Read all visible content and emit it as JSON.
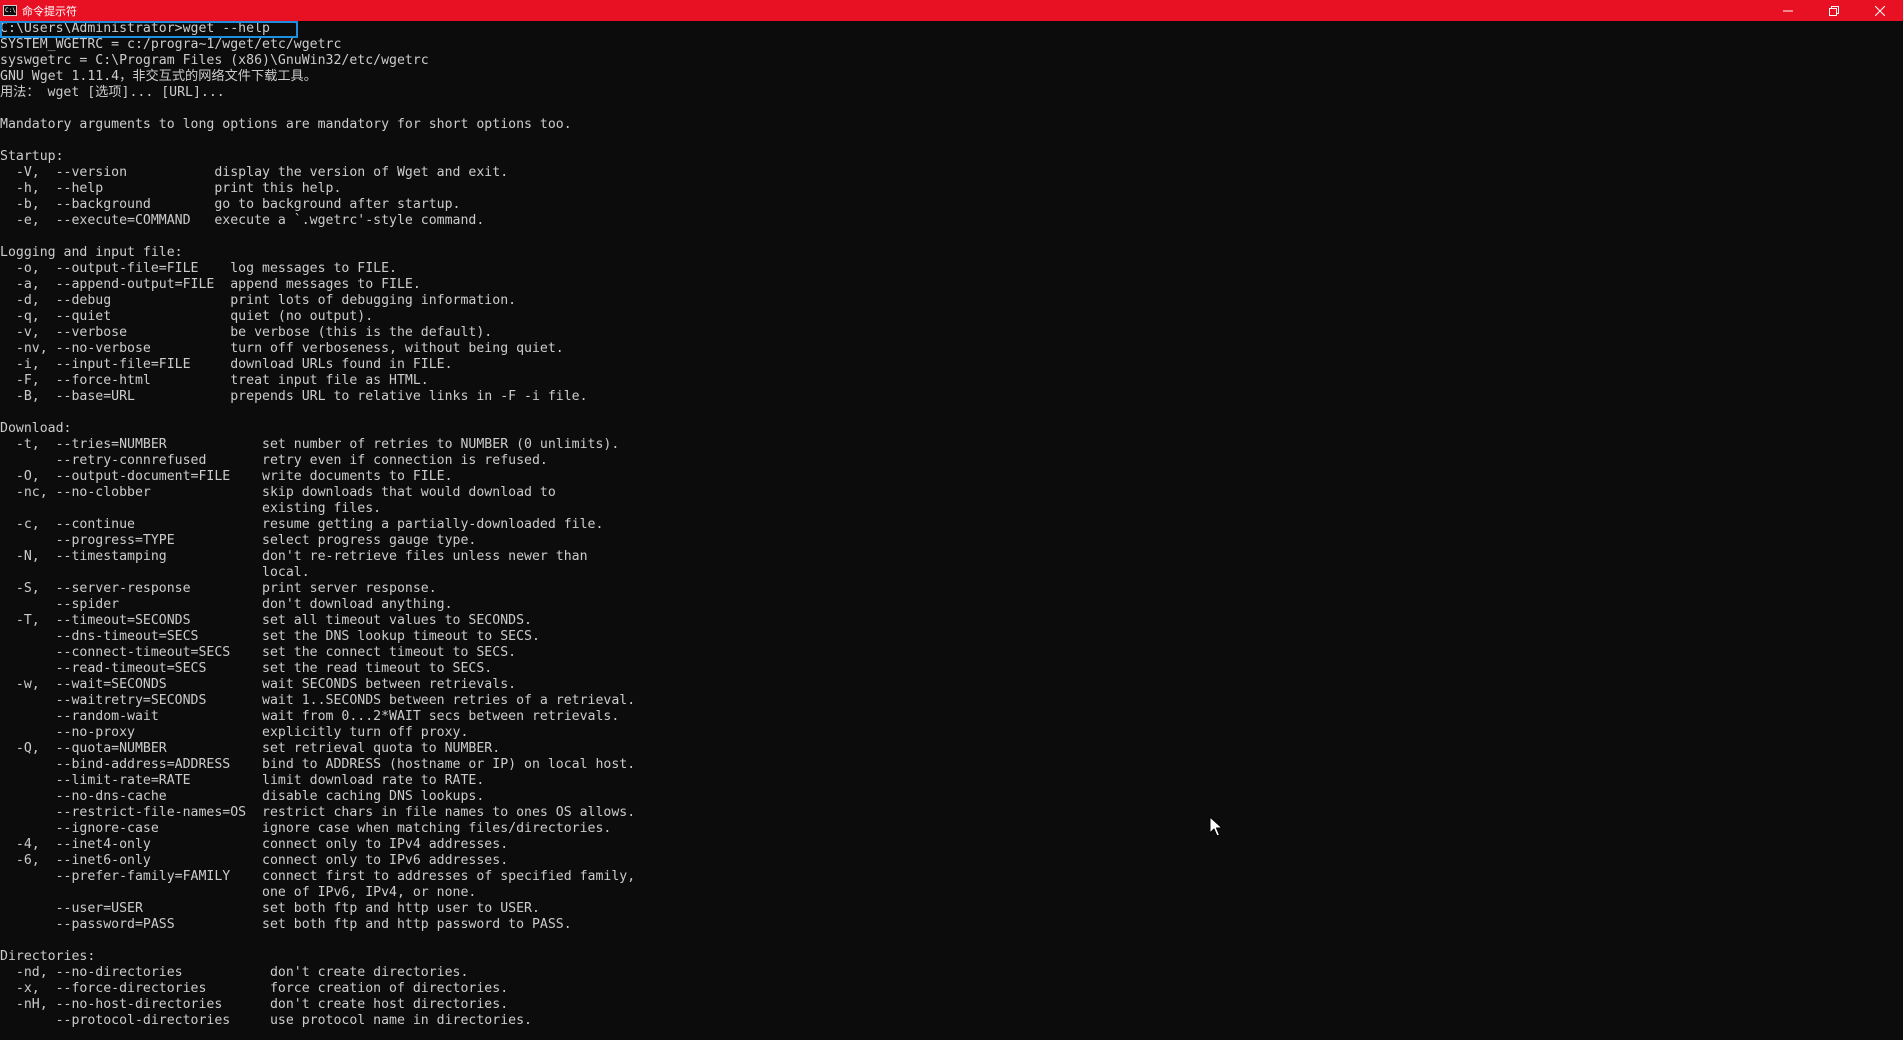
{
  "window": {
    "title": "命令提示符",
    "app_icon_text": "C:\\",
    "title_bar_color": "#e81123",
    "controls": [
      "minimize-icon",
      "restore-icon",
      "close-icon"
    ]
  },
  "console": {
    "text_color": "#cccccc",
    "background": "#0c0c0c",
    "highlight_color": "#1e8fe0",
    "lines": [
      "C:\\Users\\Administrator>wget --help",
      "SYSTEM_WGETRC = c:/progra~1/wget/etc/wgetrc",
      "syswgetrc = C:\\Program Files (x86)\\GnuWin32/etc/wgetrc",
      "GNU Wget 1.11.4，非交互式的网络文件下载工具。",
      "用法： wget [选项]... [URL]...",
      "",
      "Mandatory arguments to long options are mandatory for short options too.",
      "",
      "Startup:",
      "  -V,  --version           display the version of Wget and exit.",
      "  -h,  --help              print this help.",
      "  -b,  --background        go to background after startup.",
      "  -e,  --execute=COMMAND   execute a `.wgetrc'-style command.",
      "",
      "Logging and input file:",
      "  -o,  --output-file=FILE    log messages to FILE.",
      "  -a,  --append-output=FILE  append messages to FILE.",
      "  -d,  --debug               print lots of debugging information.",
      "  -q,  --quiet               quiet (no output).",
      "  -v,  --verbose             be verbose (this is the default).",
      "  -nv, --no-verbose          turn off verboseness, without being quiet.",
      "  -i,  --input-file=FILE     download URLs found in FILE.",
      "  -F,  --force-html          treat input file as HTML.",
      "  -B,  --base=URL            prepends URL to relative links in -F -i file.",
      "",
      "Download:",
      "  -t,  --tries=NUMBER            set number of retries to NUMBER (0 unlimits).",
      "       --retry-connrefused       retry even if connection is refused.",
      "  -O,  --output-document=FILE    write documents to FILE.",
      "  -nc, --no-clobber              skip downloads that would download to",
      "                                 existing files.",
      "  -c,  --continue                resume getting a partially-downloaded file.",
      "       --progress=TYPE           select progress gauge type.",
      "  -N,  --timestamping            don't re-retrieve files unless newer than",
      "                                 local.",
      "  -S,  --server-response         print server response.",
      "       --spider                  don't download anything.",
      "  -T,  --timeout=SECONDS         set all timeout values to SECONDS.",
      "       --dns-timeout=SECS        set the DNS lookup timeout to SECS.",
      "       --connect-timeout=SECS    set the connect timeout to SECS.",
      "       --read-timeout=SECS       set the read timeout to SECS.",
      "  -w,  --wait=SECONDS            wait SECONDS between retrievals.",
      "       --waitretry=SECONDS       wait 1..SECONDS between retries of a retrieval.",
      "       --random-wait             wait from 0...2*WAIT secs between retrievals.",
      "       --no-proxy                explicitly turn off proxy.",
      "  -Q,  --quota=NUMBER            set retrieval quota to NUMBER.",
      "       --bind-address=ADDRESS    bind to ADDRESS (hostname or IP) on local host.",
      "       --limit-rate=RATE         limit download rate to RATE.",
      "       --no-dns-cache            disable caching DNS lookups.",
      "       --restrict-file-names=OS  restrict chars in file names to ones OS allows.",
      "       --ignore-case             ignore case when matching files/directories.",
      "  -4,  --inet4-only              connect only to IPv4 addresses.",
      "  -6,  --inet6-only              connect only to IPv6 addresses.",
      "       --prefer-family=FAMILY    connect first to addresses of specified family,",
      "                                 one of IPv6, IPv4, or none.",
      "       --user=USER               set both ftp and http user to USER.",
      "       --password=PASS           set both ftp and http password to PASS.",
      "",
      "Directories:",
      "  -nd, --no-directories           don't create directories.",
      "  -x,  --force-directories        force creation of directories.",
      "  -nH, --no-host-directories      don't create host directories.",
      "       --protocol-directories     use protocol name in directories."
    ]
  }
}
